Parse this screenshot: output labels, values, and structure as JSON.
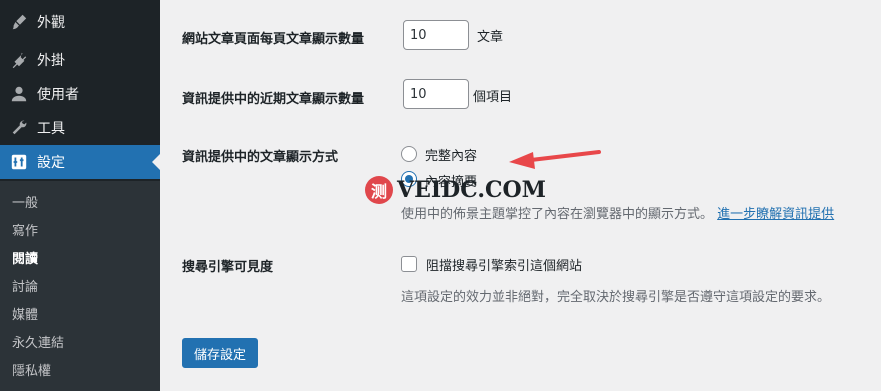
{
  "sidebar": {
    "menu": [
      {
        "label": "外觀",
        "icon": "paintbrush-icon"
      },
      {
        "label": "外掛",
        "icon": "plugin-icon"
      },
      {
        "label": "使用者",
        "icon": "user-icon"
      },
      {
        "label": "工具",
        "icon": "wrench-icon"
      },
      {
        "label": "設定",
        "icon": "settings-icon"
      }
    ],
    "submenu": [
      "一般",
      "寫作",
      "閱讀",
      "討論",
      "媒體",
      "永久連結",
      "隱私權"
    ],
    "current_submenu": "閱讀"
  },
  "settings": {
    "posts_per_page": {
      "label": "網站文章頁面每頁文章顯示數量",
      "value": "10",
      "unit": "文章"
    },
    "feed_items": {
      "label": "資訊提供中的近期文章顯示數量",
      "value": "10",
      "unit": "個項目"
    },
    "feed_display": {
      "label": "資訊提供中的文章顯示方式",
      "options": [
        "完整內容",
        "內容摘要"
      ],
      "selected": "內容摘要",
      "description": "使用中的佈景主題掌控了內容在瀏覽器中的顯示方式。",
      "link_text": "進一步瞭解資訊提供"
    },
    "search_visibility": {
      "label": "搜尋引擎可見度",
      "checkbox_label": "阻擋搜尋引擎索引這個網站",
      "checked": false,
      "description": "這項設定的效力並非絕對，完全取決於搜尋引擎是否遵守這項設定的要求。"
    }
  },
  "save_button": "儲存設定",
  "watermark": {
    "logo_char": "测",
    "text": "VEIDC.COM"
  },
  "colors": {
    "accent": "#2271b1",
    "sidebar": "#1d2327",
    "annotation_arrow": "#e8474a"
  }
}
